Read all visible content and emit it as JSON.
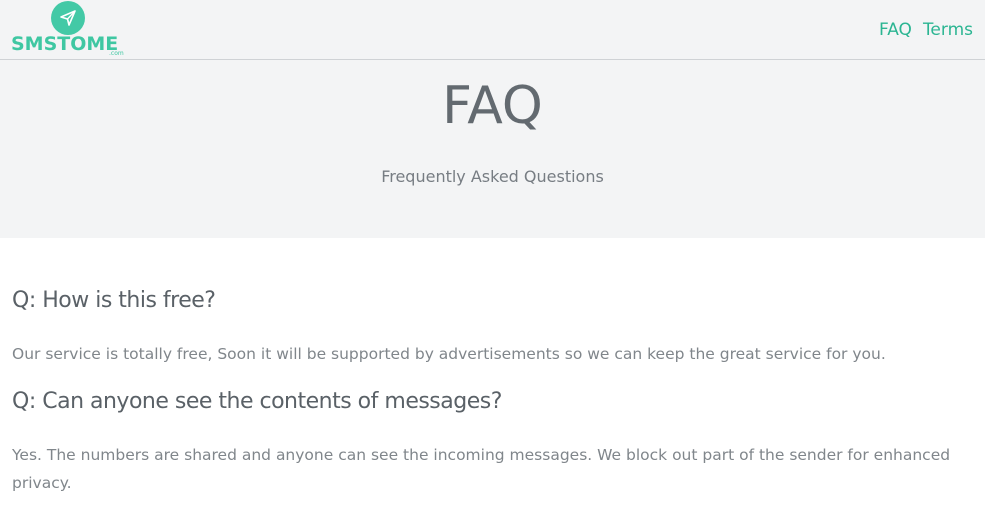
{
  "brand": {
    "logo_text": "SMSTOME",
    "logo_suffix": ".com",
    "accent_color": "#3fc7a2"
  },
  "nav": {
    "items": [
      {
        "label": "FAQ"
      },
      {
        "label": "Terms"
      }
    ]
  },
  "hero": {
    "title": "FAQ",
    "subtitle": "Frequently Asked Questions"
  },
  "faq": [
    {
      "question": "Q: How is this free?",
      "answer": "Our service is totally free, Soon it will be supported by advertisements so we can keep the great service for you."
    },
    {
      "question": "Q: Can anyone see the contents of messages?",
      "answer": "Yes. The numbers are shared and anyone can see the incoming messages. We block out part of the sender for enhanced privacy."
    }
  ]
}
